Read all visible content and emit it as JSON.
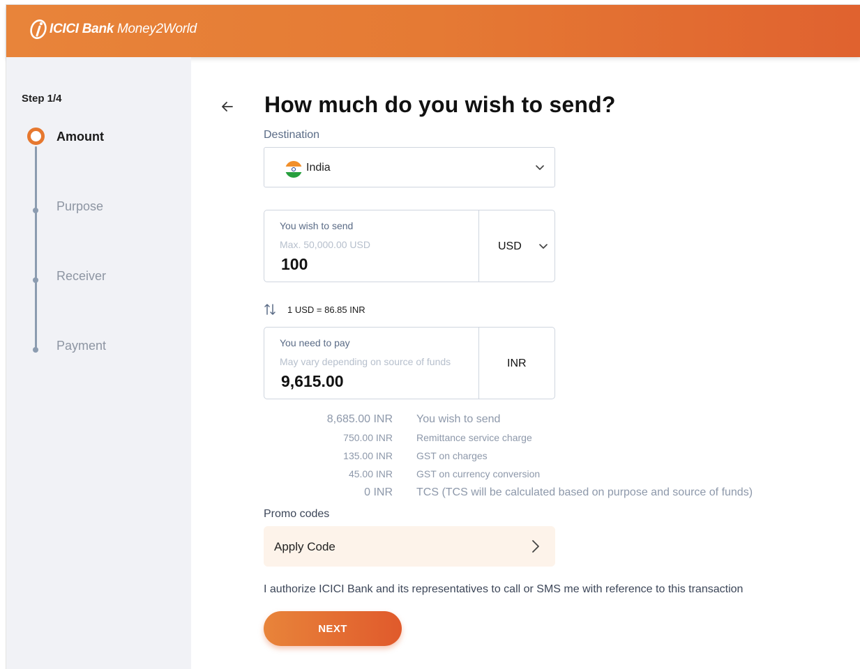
{
  "brand": {
    "name_bold": "ICICI Bank",
    "name_sub": "Money2World",
    "accent_color": "#e6782f",
    "header_gradient": [
      "#e8843a",
      "#e0622f"
    ]
  },
  "sidebar": {
    "step_label": "Step 1/4",
    "steps": [
      {
        "label": "Amount",
        "state": "active"
      },
      {
        "label": "Purpose",
        "state": "pending"
      },
      {
        "label": "Receiver",
        "state": "pending"
      },
      {
        "label": "Payment",
        "state": "pending"
      }
    ]
  },
  "main": {
    "title": "How much do you wish to send?",
    "destination": {
      "label": "Destination",
      "value": "India",
      "flag_icon": "india-flag-icon"
    },
    "send": {
      "label": "You wish to send",
      "hint": "Max. 50,000.00 USD",
      "value": "100",
      "currency": "USD"
    },
    "rate": {
      "text": "1 USD = 86.85 INR"
    },
    "pay": {
      "label": "You need to pay",
      "hint": "May vary depending on source of funds",
      "value": "9,615.00",
      "currency": "INR"
    },
    "breakdown": [
      {
        "amount": "8,685.00 INR",
        "description": "You wish to send"
      },
      {
        "amount": "750.00 INR",
        "description": "Remittance service charge"
      },
      {
        "amount": "135.00 INR",
        "description": "GST on charges"
      },
      {
        "amount": "45.00 INR",
        "description": "GST on currency conversion"
      },
      {
        "amount": "0 INR",
        "description": "TCS (TCS will be calculated based on purpose and source of funds)"
      }
    ],
    "promo": {
      "label": "Promo codes",
      "button_label": "Apply Code"
    },
    "authorize_text": "I authorize ICICI Bank and its representatives to call or SMS me with reference to this transaction",
    "next_label": "NEXT"
  }
}
